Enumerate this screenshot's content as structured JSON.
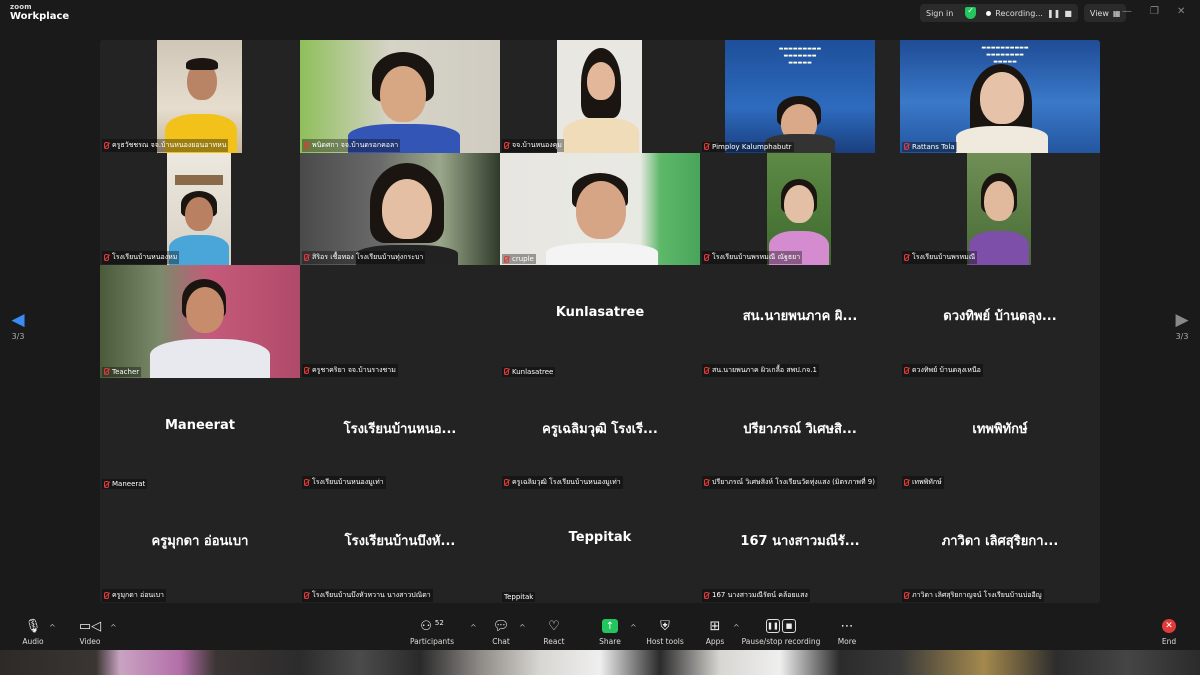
{
  "app": {
    "logo_line1": "zoom",
    "logo_line2": "Workplace"
  },
  "topbar": {
    "sign_in": "Sign in",
    "recording": "Recording...",
    "view": "View"
  },
  "gallery": {
    "page_indicator_left": "3/3",
    "page_indicator_right": "3/3",
    "video_tiles": [
      {
        "name": "ครูธวัชชรณ จจ.บ้านหนองยอนอาทหน"
      },
      {
        "name": "พนิดศกา จจ.บ้านดรอกคอลา"
      },
      {
        "name": "จจ.บ้านหนองคุม"
      },
      {
        "name": "Pimploy Kalumphabutr"
      },
      {
        "name": "Rattans Tola"
      },
      {
        "name": "โรงเรียนบ้านหนองหม"
      },
      {
        "name": "สิริอร เชื้อทอง โรงเรียนบ้านทุ่งกระบา"
      },
      {
        "name": "cruple"
      },
      {
        "name": "โรงเรียนบ้านพรหมณี ณัฐธยา"
      },
      {
        "name": "โรงเรียนบ้านพรหมณี"
      },
      {
        "name": "Teacher"
      }
    ],
    "name_tiles": [
      {
        "big": "",
        "small": "ครูชาคริยา จจ.บ้านรางชาม"
      },
      {
        "big": "Kunlasatree",
        "small": "Kunlasatree"
      },
      {
        "big": "สน.นายพนภาค  ผิ...",
        "small": "สน.นายพนภาค  ผิวเกลื้อ สพป.กจ.1"
      },
      {
        "big": "ดวงทิพย์ บ้านดลุง...",
        "small": "ดวงทิพย์ บ้านดลุงเหนือ"
      },
      {
        "big": "Maneerat",
        "small": "Maneerat"
      },
      {
        "big": "โรงเรียนบ้านหนอ...",
        "small": "โรงเรียนบ้านหนองมูเท่า"
      },
      {
        "big": "ครูเฉลิมวุฒิ โรงเรี...",
        "small": "ครูเฉลิมวุฒิ โรงเรียนบ้านหนองมูเท่า"
      },
      {
        "big": "ปรียาภรณ์ วิเศษสิ...",
        "small": "ปรียาภรณ์ วิเศษสิงห์ โรงเรียนวัดทุ่งแสง (มิตรภาพที่ 9)"
      },
      {
        "big": "เทพพิทักษ์",
        "small": "เทพพิทักษ์"
      },
      {
        "big": "ครูมุกดา อ่อนเบา",
        "small": "ครูมุกดา อ่อนเบา"
      },
      {
        "big": "โรงเรียนบ้านบึงหั...",
        "small": "โรงเรียนบ้านบึงหัวหวาน  นางสาวปณิดา"
      },
      {
        "big": "Teppitak",
        "small": "Teppitak"
      },
      {
        "big": "167 นางสาวมณีรั...",
        "small": "167 นางสาวมณีรัตน์ คล้อยแสง"
      },
      {
        "big": "ภาวิดา เลิศสุริยกา...",
        "small": "ภาวิดา เลิศสุริยกาญจน์ โรงเรียนบ้านบ่ออีญู"
      }
    ]
  },
  "toolbar": {
    "audio": "Audio",
    "video": "Video",
    "participants": "Participants",
    "participants_count": "52",
    "chat": "Chat",
    "react": "React",
    "share": "Share",
    "host_tools": "Host tools",
    "apps": "Apps",
    "pause_stop": "Pause/stop recording",
    "more": "More",
    "end": "End"
  },
  "colors": {
    "recording_green": "#22c55e",
    "end_red": "#e03a3a",
    "muted_red": "#e03a3a",
    "background": "#1a1a1a"
  }
}
